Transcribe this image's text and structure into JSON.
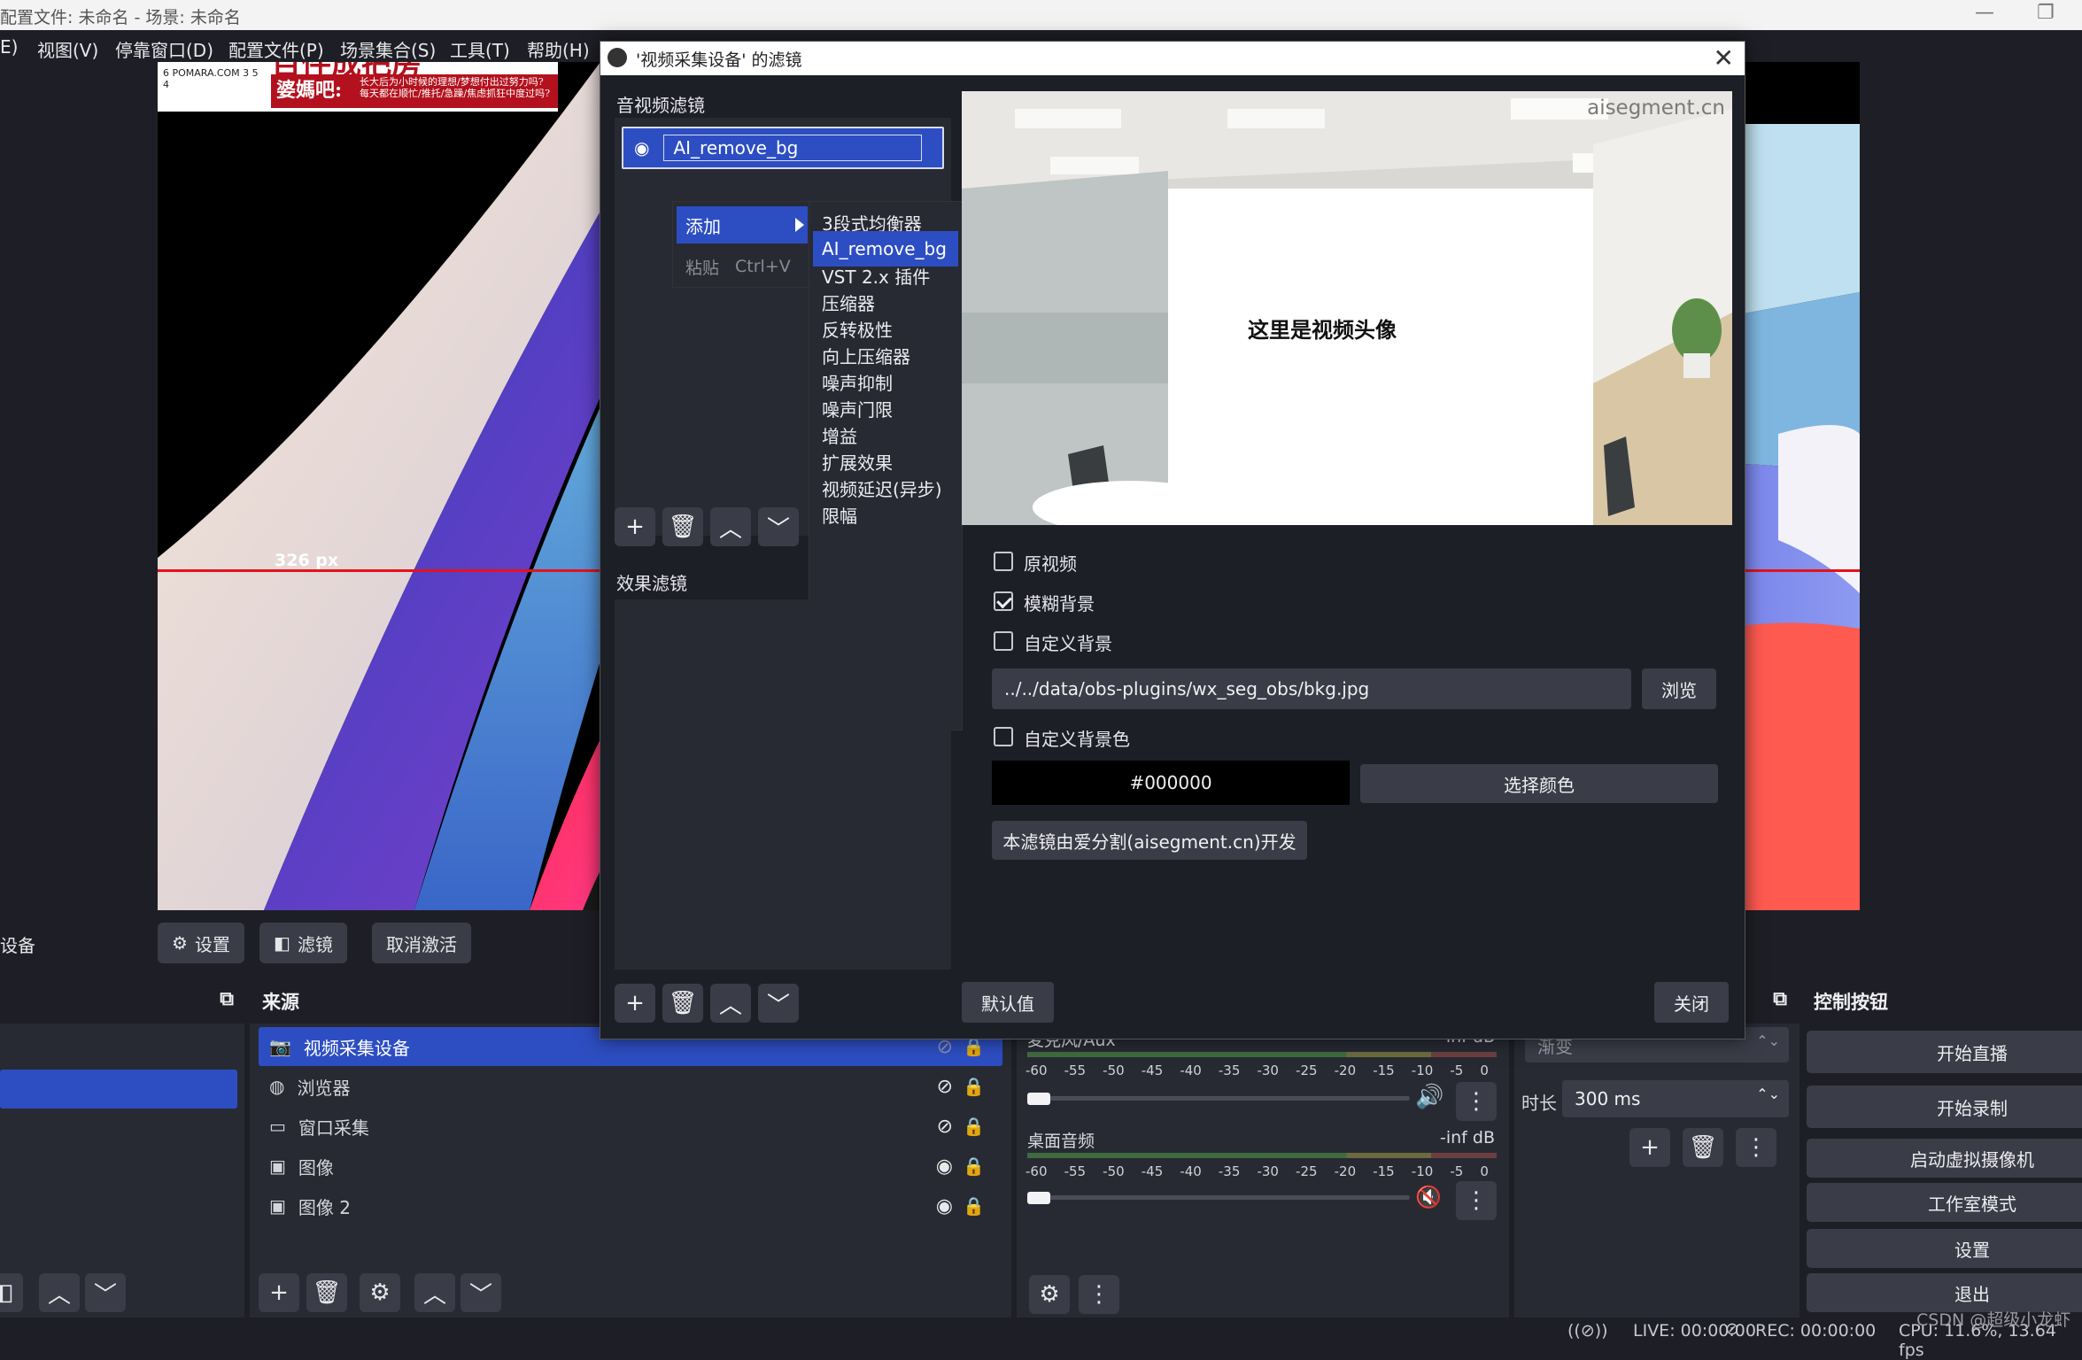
{
  "window": {
    "title": "配置文件: 未命名 - 场景: 未命名",
    "minimize": "—",
    "maximize": "❐"
  },
  "menu": [
    "E)",
    "视图(V)",
    "停靠窗口(D)",
    "配置文件(P)",
    "场景集合(S)",
    "工具(T)",
    "帮助(H)"
  ],
  "preview": {
    "measure_label": "326 px",
    "banner_headline": "百件成把房",
    "banner_red_text": "婆媽吧:",
    "banner_small_1": "长大后为小时候的理想/梦想付出过努力吗?",
    "banner_small_2": "每天都在顺忙/推托/急躁/焦虑抓狂中度过吗?",
    "banner_clock": "6  POMARA.COM  3  5   4"
  },
  "source_toolbar": {
    "device_label": "设备",
    "settings": "设置",
    "filters": "滤镜",
    "deactivate": "取消激活"
  },
  "sources": {
    "title": "来源",
    "items": [
      {
        "label": "视频采集设备",
        "icon": "camera-icon",
        "visible": false
      },
      {
        "label": "浏览器",
        "icon": "globe-icon",
        "visible": false
      },
      {
        "label": "窗口采集",
        "icon": "window-icon",
        "visible": false
      },
      {
        "label": "图像",
        "icon": "image-icon",
        "visible": true
      },
      {
        "label": "图像 2",
        "icon": "image-icon",
        "visible": true
      }
    ]
  },
  "mixer": {
    "ch1_name": "麦克风/Aux",
    "ch1_db": "-inf dB",
    "ch2_name": "桌面音频",
    "ch2_db": "-inf dB",
    "scale": [
      "-60",
      "-55",
      "-50",
      "-45",
      "-40",
      "-35",
      "-30",
      "-25",
      "-20",
      "-15",
      "-10",
      "-5",
      "0"
    ],
    "ch1_muted": false,
    "ch2_muted": true
  },
  "transitions": {
    "type": "渐变",
    "duration_label": "时长",
    "duration_value": "300 ms"
  },
  "controls": {
    "title": "控制按钮",
    "buttons": [
      "开始直播",
      "开始录制",
      "启动虚拟摄像机",
      "工作室模式",
      "设置",
      "退出"
    ]
  },
  "status": {
    "live": "LIVE: 00:00:00",
    "rec": "REC: 00:00:00",
    "cpu": "CPU: 11.6%, 13.64 fps",
    "watermark": "CSDN @超级小龙虾"
  },
  "dialog": {
    "title": "'视频采集设备' 的滤镜",
    "av_filters_label": "音视频滤镜",
    "effect_filters_label": "效果滤镜",
    "filter_item": "AI_remove_bg",
    "context_menu": {
      "add": "添加",
      "paste": "粘贴",
      "paste_shortcut": "Ctrl+V"
    },
    "submenu": [
      "3段式均衡器",
      "AI_remove_bg",
      "VST 2.x 插件",
      "压缩器",
      "反转极性",
      "向上压缩器",
      "噪声抑制",
      "噪声门限",
      "增益",
      "扩展效果",
      "视频延迟(异步)",
      "限幅"
    ],
    "submenu_highlight": "AI_remove_bg",
    "preview_watermark": "aisegment.cn",
    "preview_card_text": "这里是视频头像",
    "options": {
      "original_video": "原视频",
      "blur_bg": "模糊背景",
      "custom_bg": "自定义背景",
      "bg_path": "../../data/obs-plugins/wx_seg_obs/bkg.jpg",
      "browse": "浏览",
      "custom_bg_color": "自定义背景色",
      "color_value": "#000000",
      "choose_color": "选择颜色",
      "credit": "本滤镜由爱分割(aisegment.cn)开发"
    },
    "checks": {
      "original_video": false,
      "blur_bg": true,
      "custom_bg": false,
      "custom_bg_color": false
    },
    "defaults": "默认值",
    "close": "关闭"
  },
  "colors": {
    "accent": "#2d4ec2",
    "guide_red": "#e4121a",
    "bg_dark": "#1e1f26",
    "panel": "#272a33",
    "button": "#3a3c48"
  }
}
